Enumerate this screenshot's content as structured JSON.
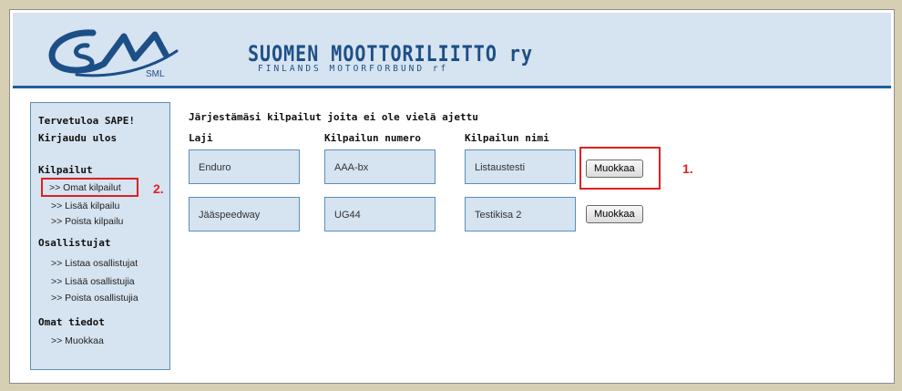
{
  "header": {
    "logo_text": "SML",
    "title_main": "SUOMEN MOOTTORILIITTO ry",
    "title_sub": "FINLANDS MOTORFORBUND rf"
  },
  "sidebar": {
    "welcome": "Tervetuloa SAPE!",
    "logout": "Kirjaudu ulos",
    "section_competitions": "Kilpailut",
    "own_competitions": ">> Omat kilpailut",
    "add_competition": ">> Lisää kilpailu",
    "remove_competition": ">> Poista kilpailu",
    "section_participants": "Osallistujat",
    "list_participants": ">> Listaa osallistujat",
    "add_participants": ">> Lisää osallistujia",
    "remove_participants": ">> Poista osallistujia",
    "section_own_info": "Omat tiedot",
    "edit_info": ">> Muokkaa"
  },
  "main": {
    "heading": "Järjestämäsi kilpailut joita ei ole vielä ajettu",
    "columns": [
      "Laji",
      "Kilpailun numero",
      "Kilpailun nimi"
    ],
    "rows": [
      {
        "laji": "Enduro",
        "numero": "AAA-bx",
        "nimi": "Listaustesti",
        "button": "Muokkaa"
      },
      {
        "laji": "Jääspeedway",
        "numero": "UG44",
        "nimi": "Testikisa 2",
        "button": "Muokkaa"
      }
    ]
  },
  "annotations": {
    "label_1": "1.",
    "label_2": "2."
  },
  "colors": {
    "header_bg": "#d6e3f0",
    "header_rule": "#1e5f9a",
    "cell_border": "#5a8fb8",
    "annotation_red": "#e02020",
    "title_blue": "#1d4f87"
  }
}
